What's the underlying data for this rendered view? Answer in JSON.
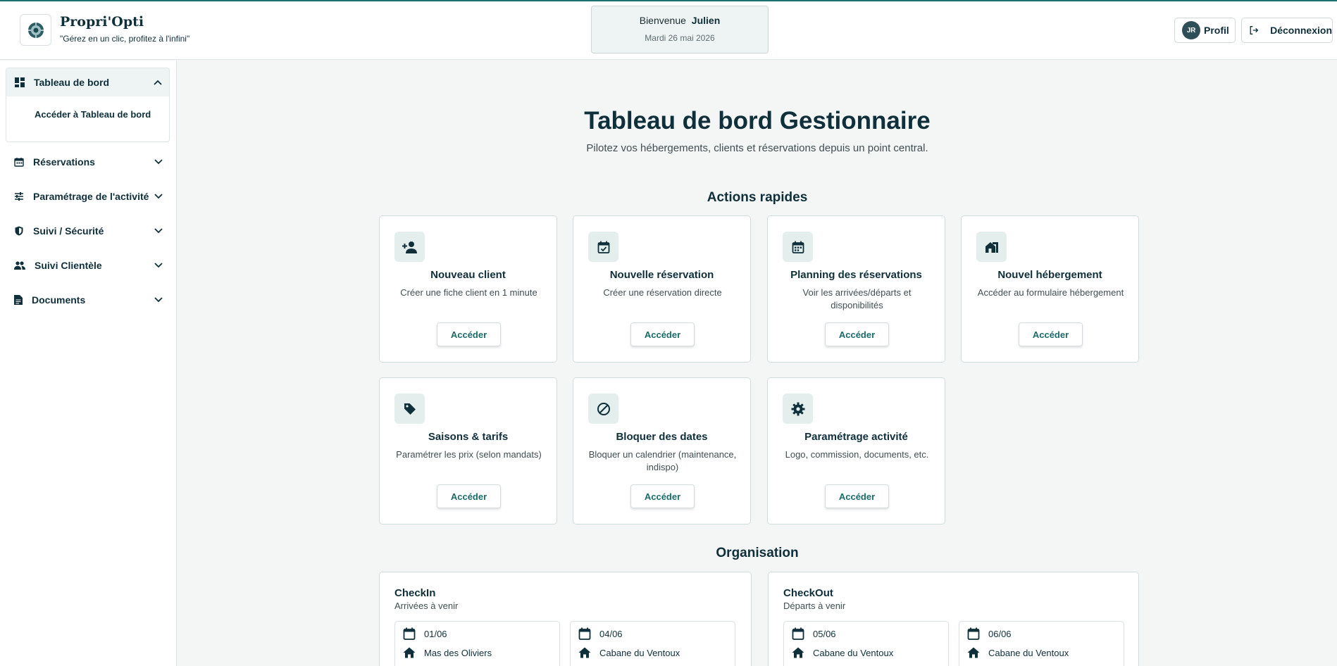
{
  "app": {
    "name": "Propri'Opti",
    "tagline": "\"Gérez en un clic, profitez à l'infini\""
  },
  "header": {
    "welcome_label": "Bienvenue",
    "user_first_name": "Julien",
    "date": "Mardi 26 mai 2026",
    "avatar_initials": "JR",
    "profile_label": "Profil",
    "logout_label": "Déconnexion"
  },
  "sidebar": {
    "dashboard": {
      "label": "Tableau de bord",
      "sub_item": "Accéder à Tableau de bord",
      "icon": "dashboard-icon"
    },
    "items": [
      {
        "label": "Réservations",
        "icon": "calendar-icon"
      },
      {
        "label": "Paramétrage de l'activité",
        "icon": "sliders-icon"
      },
      {
        "label": "Suivi / Sécurité",
        "icon": "shield-icon"
      },
      {
        "label": "Suivi Clientèle",
        "icon": "people-icon"
      },
      {
        "label": "Documents",
        "icon": "document-icon"
      }
    ]
  },
  "main": {
    "title": "Tableau de bord Gestionnaire",
    "subtitle": "Pilotez vos hébergements, clients et réservations depuis un point central.",
    "quick_actions_title": "Actions rapides",
    "cards": [
      {
        "title": "Nouveau client",
        "desc": "Créer une fiche client en 1 minute",
        "button": "Accéder",
        "icon": "person-add-icon"
      },
      {
        "title": "Nouvelle réservation",
        "desc": "Créer une réservation directe",
        "button": "Accéder",
        "icon": "calendar-check-icon"
      },
      {
        "title": "Planning des réservations",
        "desc": "Voir les arrivées/départs et disponibilités",
        "button": "Accéder",
        "icon": "calendar-grid-icon"
      },
      {
        "title": "Nouvel hébergement",
        "desc": "Accéder au formulaire hébergement",
        "button": "Accéder",
        "icon": "house-icon"
      },
      {
        "title": "Saisons & tarifs",
        "desc": "Paramétrer les prix (selon mandats)",
        "button": "Accéder",
        "icon": "tag-icon"
      },
      {
        "title": "Bloquer des dates",
        "desc": "Bloquer un calendrier (maintenance, indispo)",
        "button": "Accéder",
        "icon": "block-icon"
      },
      {
        "title": "Paramétrage activité",
        "desc": "Logo, commission, documents, etc.",
        "button": "Accéder",
        "icon": "gear-icon"
      }
    ],
    "organisation_title": "Organisation",
    "checkin": {
      "title": "CheckIn",
      "subtitle": "Arrivées à venir",
      "entries": [
        {
          "date": "01/06",
          "place": "Mas des Oliviers"
        },
        {
          "date": "04/06",
          "place": "Cabane du Ventoux"
        }
      ]
    },
    "checkout": {
      "title": "CheckOut",
      "subtitle": "Départs à venir",
      "entries": [
        {
          "date": "05/06",
          "place": "Cabane du Ventoux"
        },
        {
          "date": "06/06",
          "place": "Cabane du Ventoux"
        }
      ]
    }
  },
  "colors": {
    "primary": "#0f2f3a",
    "accent": "#1a6b6b",
    "icon_bg": "#e3eeed"
  }
}
